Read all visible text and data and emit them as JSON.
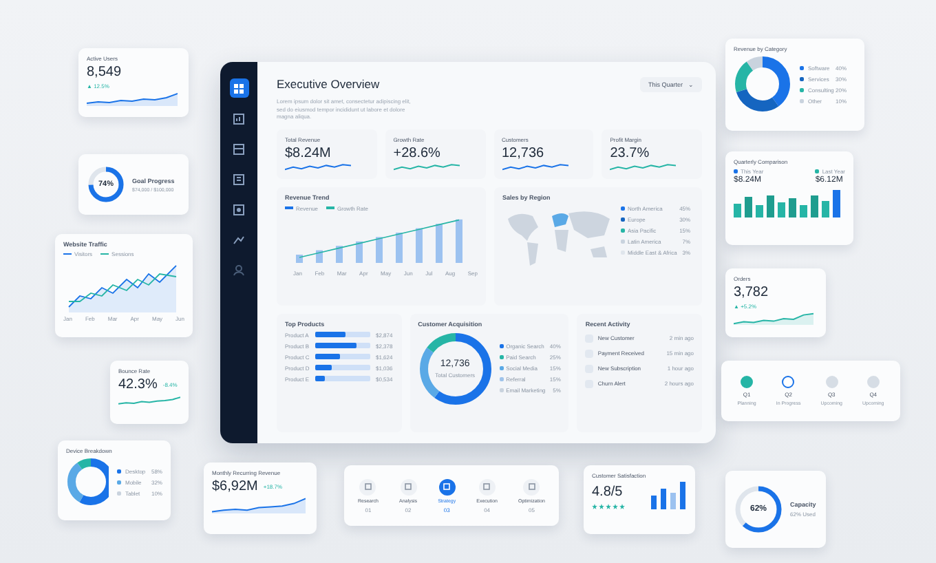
{
  "active_users": {
    "title": "Active Users",
    "value": "8,549",
    "change": "▲ 12.5%"
  },
  "goal_progress": {
    "percent": "74%",
    "title": "Goal Progress",
    "detail": "$74,000 / $100,000"
  },
  "website_traffic": {
    "title": "Website Traffic",
    "legend": [
      "Visitors",
      "Sessions"
    ],
    "months": [
      "Jan",
      "Feb",
      "Mar",
      "Apr",
      "May",
      "Jun"
    ]
  },
  "bounce_rate": {
    "title": "Bounce Rate",
    "value": "42.3%",
    "change": "-8.4%"
  },
  "device_breakdown": {
    "title": "Device Breakdown",
    "items": [
      {
        "label": "Desktop",
        "value": "58%",
        "color": "#1a73e8"
      },
      {
        "label": "Mobile",
        "value": "32%",
        "color": "#5aa9e6"
      },
      {
        "label": "Tablet",
        "value": "10%",
        "color": "#c9d3de"
      }
    ]
  },
  "dashboard": {
    "sidebar": [
      {
        "selected": true
      },
      {
        "selected": false
      },
      {
        "selected": false
      },
      {
        "selected": false
      },
      {
        "selected": false
      },
      {
        "selected": false
      },
      {
        "selected": false
      }
    ],
    "title": "Executive Overview",
    "description": "Lorem ipsum dolor sit amet, consectetur adipiscing elit, sed do eiusmod tempor incididunt ut labore et dolore magna aliqua.",
    "period": "This Quarter",
    "period_caret": "⌄",
    "kpis": [
      {
        "label": "Total Revenue",
        "value": "$8.24M"
      },
      {
        "label": "Growth Rate",
        "value": "+28.6%"
      },
      {
        "label": "Customers",
        "value": "12,736"
      },
      {
        "label": "Profit Margin",
        "value": "23.7%"
      }
    ],
    "revenue_trend": {
      "title": "Revenue Trend",
      "legend": [
        "Revenue",
        "Growth Rate"
      ],
      "months": [
        "Jan",
        "Feb",
        "Mar",
        "Apr",
        "May",
        "Jun",
        "Jul",
        "Aug",
        "Sep"
      ]
    },
    "sales_by_region": {
      "title": "Sales by Region",
      "regions": [
        {
          "label": "North America",
          "value": "45%",
          "color": "#1a73e8"
        },
        {
          "label": "Europe",
          "value": "30%",
          "color": "#1565c0"
        },
        {
          "label": "Asia Pacific",
          "value": "15%",
          "color": "#26b5a6"
        },
        {
          "label": "Latin America",
          "value": "7%",
          "color": "#c9d3de"
        },
        {
          "label": "Middle East & Africa",
          "value": "3%",
          "color": "#dfe5ec"
        }
      ]
    },
    "top_products": {
      "title": "Top Products",
      "items": [
        {
          "label": "Product A",
          "value": "$2,874",
          "level": 0.55
        },
        {
          "label": "Product B",
          "value": "$2,378",
          "level": 0.75
        },
        {
          "label": "Product C",
          "value": "$1,624",
          "level": 0.45
        },
        {
          "label": "Product D",
          "value": "$1,036",
          "level": 0.3
        },
        {
          "label": "Product E",
          "value": "$0,534",
          "level": 0.17
        }
      ]
    },
    "customer_acquisition": {
      "title": "Customer Acquisition",
      "total": "12,736",
      "total_label": "Total Customers",
      "channels": [
        {
          "label": "Organic Search",
          "value": "40%",
          "color": "#1a73e8"
        },
        {
          "label": "Paid Search",
          "value": "25%",
          "color": "#26b5a6"
        },
        {
          "label": "Social Media",
          "value": "15%",
          "color": "#5aa9e6"
        },
        {
          "label": "Referral",
          "value": "15%",
          "color": "#9fc3ea"
        },
        {
          "label": "Email Marketing",
          "value": "5%",
          "color": "#c9d3de"
        }
      ]
    },
    "recent_activity": {
      "title": "Recent Activity",
      "items": [
        {
          "label": "New Customer",
          "time": "2 min ago"
        },
        {
          "label": "Payment Received",
          "time": "15 min ago"
        },
        {
          "label": "New Subscription",
          "time": "1 hour ago"
        },
        {
          "label": "Churn Alert",
          "time": "2 hours ago"
        }
      ]
    }
  },
  "mrr": {
    "title": "Monthly Recurring Revenue",
    "value": "$6,92M",
    "change": "+18.7%"
  },
  "stages": {
    "steps": [
      {
        "label": "Research",
        "number": "01",
        "selected": false
      },
      {
        "label": "Analysis",
        "number": "02",
        "selected": false
      },
      {
        "label": "Strategy",
        "number": "03",
        "selected": true
      },
      {
        "label": "Execution",
        "number": "04",
        "selected": false
      },
      {
        "label": "Optimization",
        "number": "05",
        "selected": false
      }
    ]
  },
  "customer_satisfaction": {
    "title": "Customer Satisfaction",
    "score": "4.8/5",
    "stars": 5
  },
  "revenue_by_category": {
    "title": "Revenue by Category",
    "items": [
      {
        "label": "Software",
        "value": "40%",
        "color": "#1a73e8"
      },
      {
        "label": "Services",
        "value": "30%",
        "color": "#1565c0"
      },
      {
        "label": "Consulting",
        "value": "20%",
        "color": "#26b5a6"
      },
      {
        "label": "Other",
        "value": "10%",
        "color": "#c9d3de"
      }
    ]
  },
  "quarterly_comparison": {
    "title": "Quarterly Comparison",
    "this_year": {
      "label": "This Year",
      "value": "$8.24M",
      "color": "#1a73e8"
    },
    "last_year": {
      "label": "Last Year",
      "value": "$6.12M",
      "color": "#26b5a6"
    }
  },
  "orders": {
    "title": "Orders",
    "value": "3,782",
    "change": "▲ +5.2%"
  },
  "roadmap": {
    "milestones": [
      {
        "quarter": "Q1",
        "status": "Planning",
        "kind": "done"
      },
      {
        "quarter": "Q2",
        "status": "In Progress",
        "kind": "current"
      },
      {
        "quarter": "Q3",
        "status": "Upcoming",
        "kind": "upcoming"
      },
      {
        "quarter": "Q4",
        "status": "Upcoming",
        "kind": "upcoming"
      }
    ]
  },
  "capacity": {
    "percent": "62%",
    "title": "Capacity",
    "detail": "62% Used"
  }
}
